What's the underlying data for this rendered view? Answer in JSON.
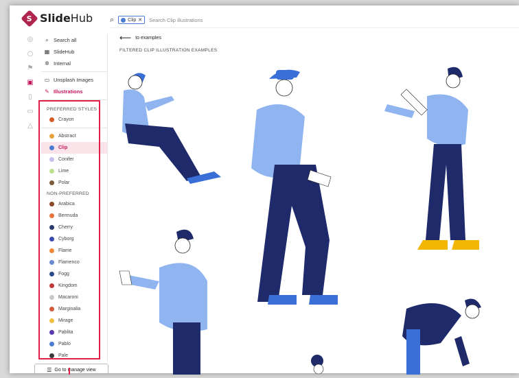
{
  "brand": {
    "name_bold": "Slide",
    "name_rest": "Hub",
    "mark": "S"
  },
  "nav": [
    {
      "label": "Search all",
      "icon": "search-icon",
      "glyph": "⌕"
    },
    {
      "label": "SlideHub",
      "icon": "slides-icon",
      "glyph": "▦"
    },
    {
      "label": "Internal",
      "icon": "gear-icon",
      "glyph": "✲"
    },
    {
      "label": "Unsplash Images",
      "icon": "image-icon",
      "glyph": "▭"
    },
    {
      "label": "Illustrations",
      "icon": "pen-icon",
      "glyph": "✎"
    }
  ],
  "sections": {
    "preferred": "PREFERRED STYLES",
    "non_preferred": "NON-PREFERRED"
  },
  "preferred_styles": [
    {
      "label": "Crayon",
      "color": "#d45a2a"
    },
    {
      "label": "Abstract",
      "color": "#e5a13a"
    },
    {
      "label": "Clip",
      "color": "#4a7bd0"
    },
    {
      "label": "Conifer",
      "color": "#c8c0e8"
    },
    {
      "label": "Lime",
      "color": "#b9e08a"
    },
    {
      "label": "Polar",
      "color": "#7a5a3a"
    }
  ],
  "non_preferred_styles": [
    {
      "label": "Arabica",
      "color": "#8a4a2a"
    },
    {
      "label": "Bermuda",
      "color": "#e5733a"
    },
    {
      "label": "Cherry",
      "color": "#2a3a6a"
    },
    {
      "label": "Cyborg",
      "color": "#3a4ab0"
    },
    {
      "label": "Flame",
      "color": "#f08a3a"
    },
    {
      "label": "Flamenco",
      "color": "#6a8ad0"
    },
    {
      "label": "Fogg",
      "color": "#2a4a8a"
    },
    {
      "label": "Kingdom",
      "color": "#c03a3a"
    },
    {
      "label": "Macaroni",
      "color": "#c8c8c8"
    },
    {
      "label": "Marginalia",
      "color": "#d05a3a"
    },
    {
      "label": "Mirage",
      "color": "#f0c040"
    },
    {
      "label": "Pablita",
      "color": "#5a3ab0"
    },
    {
      "label": "Pablo",
      "color": "#4a7bd0"
    },
    {
      "label": "Pale",
      "color": "#3a3a3a"
    }
  ],
  "manage_button": "Go to manage view",
  "search": {
    "chip": "Clip",
    "placeholder": "Search Clip illustrations"
  },
  "back_link": "to examples",
  "page_title": "FILTERED CLIP ILLUSTRATION EXAMPLES",
  "colors": {
    "accent": "#c2185b",
    "highlight": "#e0204b",
    "navy": "#1f2a6b",
    "light_blue": "#8fb4f0",
    "blue": "#3a6fd8",
    "yellow": "#f2b705"
  }
}
